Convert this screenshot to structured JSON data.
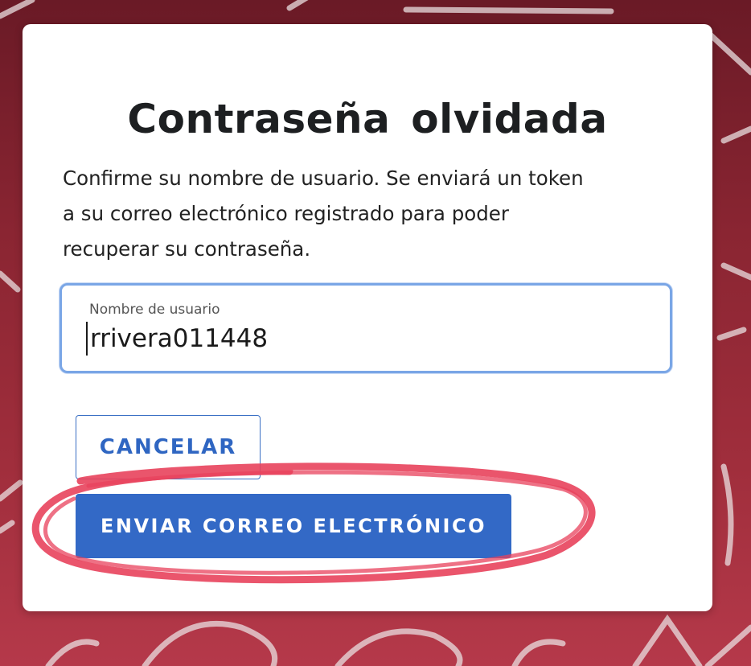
{
  "dialog": {
    "title": "Contraseña olvidada",
    "description_lines": [
      "Confirme su nombre de usuario. Se enviará un token",
      "a su correo electrónico registrado para poder",
      "recuperar su contraseña."
    ]
  },
  "username_field": {
    "label": "Nombre de usuario",
    "value": "rrivera011448"
  },
  "buttons": {
    "cancel_label": "CANCELAR",
    "send_label": "ENVIAR CORREO ELECTRÓNICO"
  },
  "colors": {
    "background": "#8a2532",
    "primary": "#3369c6",
    "field_focus_border": "#7aa6e6",
    "annotation_circle": "#e8425c"
  }
}
